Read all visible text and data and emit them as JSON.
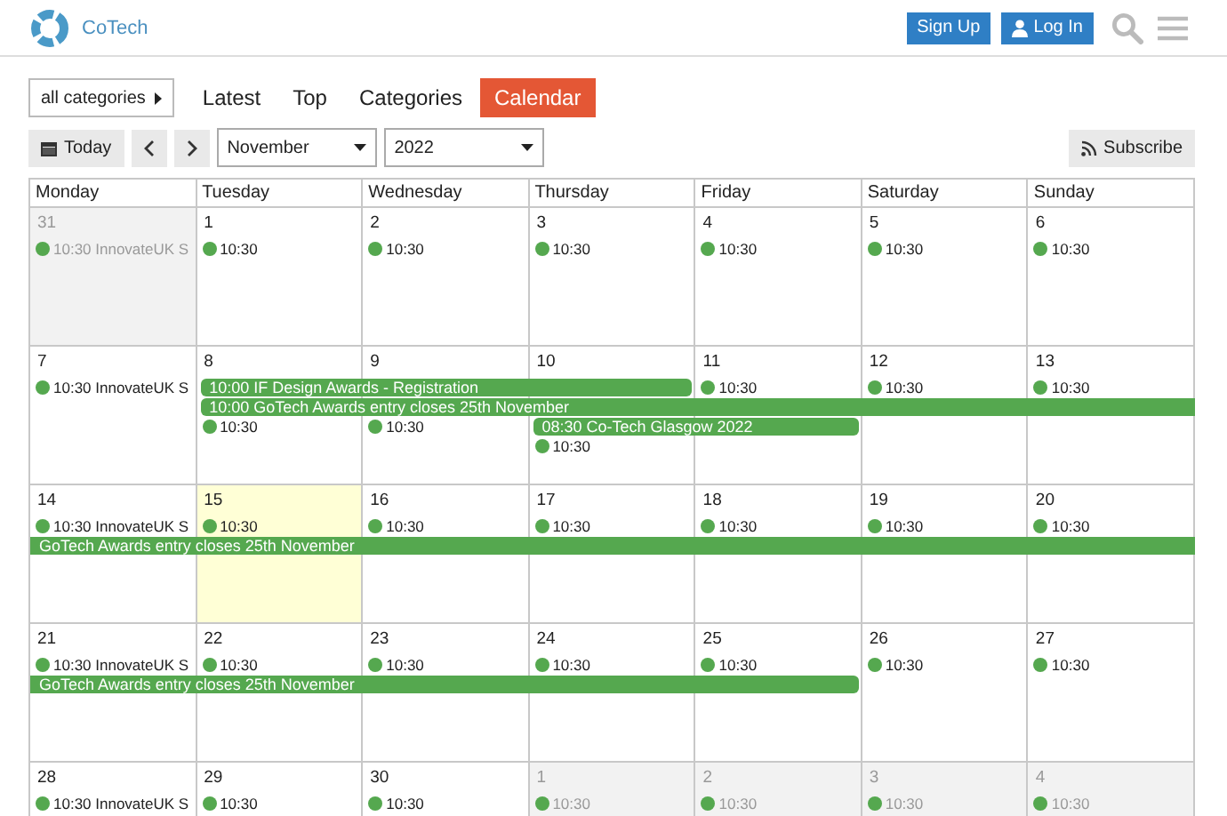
{
  "header": {
    "site_name": "CoTech",
    "buttons": [
      {
        "kind": "signup",
        "label": "Sign Up"
      },
      {
        "kind": "login",
        "label": "Log In"
      }
    ]
  },
  "nav": {
    "category_filter": "all categories",
    "tabs": [
      {
        "label": "Latest",
        "selected": false
      },
      {
        "label": "Top",
        "selected": false
      },
      {
        "label": "Categories",
        "selected": false
      },
      {
        "label": "Calendar",
        "selected": true
      }
    ]
  },
  "toolbar": {
    "today": "Today",
    "month": "November",
    "year": "2022",
    "subscribe": "Subscribe"
  },
  "calendar": {
    "weekdays": [
      "Monday",
      "Tuesday",
      "Wednesday",
      "Thursday",
      "Friday",
      "Saturday",
      "Sunday"
    ],
    "weeks": [
      {
        "days": [
          {
            "date": "31",
            "other_month": true,
            "today": false,
            "events": [
              {
                "kind": "dot",
                "text": "10:30 InnovateUK S"
              }
            ]
          },
          {
            "date": "1",
            "other_month": false,
            "today": false,
            "events": [
              {
                "kind": "dot",
                "text": "10:30"
              }
            ]
          },
          {
            "date": "2",
            "other_month": false,
            "today": false,
            "events": [
              {
                "kind": "dot",
                "text": "10:30"
              }
            ]
          },
          {
            "date": "3",
            "other_month": false,
            "today": false,
            "events": [
              {
                "kind": "dot",
                "text": "10:30"
              }
            ]
          },
          {
            "date": "4",
            "other_month": false,
            "today": false,
            "events": [
              {
                "kind": "dot",
                "text": "10:30"
              }
            ]
          },
          {
            "date": "5",
            "other_month": false,
            "today": false,
            "events": [
              {
                "kind": "dot",
                "text": "10:30"
              }
            ]
          },
          {
            "date": "6",
            "other_month": false,
            "today": false,
            "events": [
              {
                "kind": "dot",
                "text": "10:30"
              }
            ]
          }
        ]
      },
      {
        "days": [
          {
            "date": "7",
            "other_month": false,
            "today": false,
            "events": [
              {
                "kind": "dot",
                "text": "10:30 InnovateUK S"
              }
            ]
          },
          {
            "date": "8",
            "other_month": false,
            "today": false,
            "events": [
              {
                "kind": "bar",
                "text": "10:00 IF Design Awards - Registration",
                "continues_before": false,
                "continues_after": false
              },
              {
                "kind": "bar",
                "text": "10:00 GoTech Awards entry closes 25th November",
                "continues_before": false,
                "continues_after": true
              },
              {
                "kind": "dot",
                "text": "10:30"
              }
            ]
          },
          {
            "date": "9",
            "other_month": false,
            "today": false,
            "events": [
              {
                "kind": "bar_continued"
              },
              {
                "kind": "bar_continued"
              },
              {
                "kind": "dot",
                "text": "10:30"
              }
            ]
          },
          {
            "date": "10",
            "other_month": false,
            "today": false,
            "events": [
              {
                "kind": "bar_continued"
              },
              {
                "kind": "bar_continued"
              },
              {
                "kind": "bar",
                "text": "08:30 Co-Tech Glasgow 2022",
                "continues_before": false,
                "continues_after": false
              },
              {
                "kind": "dot",
                "text": "10:30"
              }
            ]
          },
          {
            "date": "11",
            "other_month": false,
            "today": false,
            "events": [
              {
                "kind": "dot",
                "text": "10:30"
              },
              {
                "kind": "bar_continued"
              },
              {
                "kind": "bar_continued"
              }
            ]
          },
          {
            "date": "12",
            "other_month": false,
            "today": false,
            "events": [
              {
                "kind": "dot",
                "text": "10:30"
              },
              {
                "kind": "bar_continued"
              }
            ]
          },
          {
            "date": "13",
            "other_month": false,
            "today": false,
            "events": [
              {
                "kind": "dot",
                "text": "10:30"
              },
              {
                "kind": "bar_continued"
              }
            ]
          }
        ]
      },
      {
        "days": [
          {
            "date": "14",
            "other_month": false,
            "today": false,
            "events": [
              {
                "kind": "dot",
                "text": "10:30 InnovateUK S"
              },
              {
                "kind": "bar",
                "text": "GoTech Awards entry closes 25th November",
                "continues_before": true,
                "continues_after": true
              }
            ]
          },
          {
            "date": "15",
            "other_month": false,
            "today": true,
            "events": [
              {
                "kind": "dot",
                "text": "10:30"
              },
              {
                "kind": "bar_continued"
              }
            ]
          },
          {
            "date": "16",
            "other_month": false,
            "today": false,
            "events": [
              {
                "kind": "dot",
                "text": "10:30"
              },
              {
                "kind": "bar_continued"
              }
            ]
          },
          {
            "date": "17",
            "other_month": false,
            "today": false,
            "events": [
              {
                "kind": "dot",
                "text": "10:30"
              },
              {
                "kind": "bar_continued"
              }
            ]
          },
          {
            "date": "18",
            "other_month": false,
            "today": false,
            "events": [
              {
                "kind": "dot",
                "text": "10:30"
              },
              {
                "kind": "bar_continued"
              }
            ]
          },
          {
            "date": "19",
            "other_month": false,
            "today": false,
            "events": [
              {
                "kind": "dot",
                "text": "10:30"
              },
              {
                "kind": "bar_continued"
              }
            ]
          },
          {
            "date": "20",
            "other_month": false,
            "today": false,
            "events": [
              {
                "kind": "dot",
                "text": "10:30"
              },
              {
                "kind": "bar_continued"
              }
            ]
          }
        ]
      },
      {
        "days": [
          {
            "date": "21",
            "other_month": false,
            "today": false,
            "events": [
              {
                "kind": "dot",
                "text": "10:30 InnovateUK S"
              },
              {
                "kind": "bar",
                "text": "GoTech Awards entry closes 25th November",
                "continues_before": true,
                "continues_after": false
              }
            ]
          },
          {
            "date": "22",
            "other_month": false,
            "today": false,
            "events": [
              {
                "kind": "dot",
                "text": "10:30"
              },
              {
                "kind": "bar_continued"
              }
            ]
          },
          {
            "date": "23",
            "other_month": false,
            "today": false,
            "events": [
              {
                "kind": "dot",
                "text": "10:30"
              },
              {
                "kind": "bar_continued"
              }
            ]
          },
          {
            "date": "24",
            "other_month": false,
            "today": false,
            "events": [
              {
                "kind": "dot",
                "text": "10:30"
              },
              {
                "kind": "bar_continued"
              }
            ]
          },
          {
            "date": "25",
            "other_month": false,
            "today": false,
            "events": [
              {
                "kind": "dot",
                "text": "10:30"
              },
              {
                "kind": "bar_continued"
              }
            ]
          },
          {
            "date": "26",
            "other_month": false,
            "today": false,
            "events": [
              {
                "kind": "dot",
                "text": "10:30"
              }
            ]
          },
          {
            "date": "27",
            "other_month": false,
            "today": false,
            "events": [
              {
                "kind": "dot",
                "text": "10:30"
              }
            ]
          }
        ]
      },
      {
        "days": [
          {
            "date": "28",
            "other_month": false,
            "today": false,
            "events": [
              {
                "kind": "dot",
                "text": "10:30 InnovateUK S"
              }
            ]
          },
          {
            "date": "29",
            "other_month": false,
            "today": false,
            "events": [
              {
                "kind": "dot",
                "text": "10:30"
              }
            ]
          },
          {
            "date": "30",
            "other_month": false,
            "today": false,
            "events": [
              {
                "kind": "dot",
                "text": "10:30"
              }
            ]
          },
          {
            "date": "1",
            "other_month": true,
            "today": false,
            "events": [
              {
                "kind": "dot",
                "text": "10:30"
              }
            ]
          },
          {
            "date": "2",
            "other_month": true,
            "today": false,
            "events": [
              {
                "kind": "dot",
                "text": "10:30"
              }
            ]
          },
          {
            "date": "3",
            "other_month": true,
            "today": false,
            "events": [
              {
                "kind": "dot",
                "text": "10:30"
              }
            ]
          },
          {
            "date": "4",
            "other_month": true,
            "today": false,
            "events": [
              {
                "kind": "dot",
                "text": "10:30"
              }
            ]
          }
        ]
      }
    ]
  }
}
